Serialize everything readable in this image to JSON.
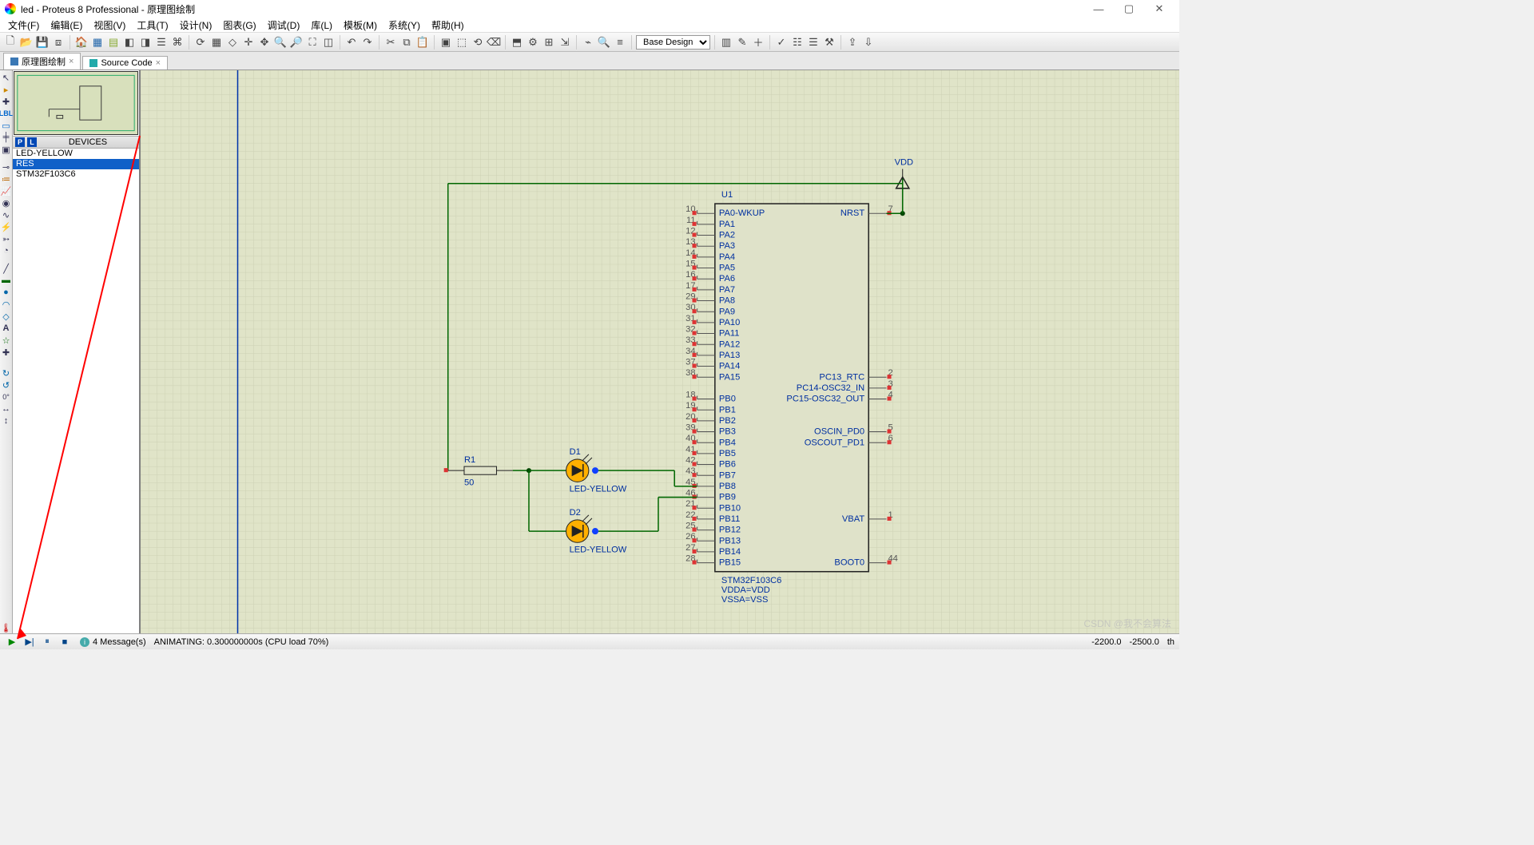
{
  "titlebar": {
    "title": "led - Proteus 8 Professional - 原理图绘制"
  },
  "menubar": [
    "文件(F)",
    "编辑(E)",
    "视图(V)",
    "工具(T)",
    "设计(N)",
    "图表(G)",
    "调试(D)",
    "库(L)",
    "模板(M)",
    "系统(Y)",
    "帮助(H)"
  ],
  "toolbar_combo": "Base Design",
  "tabs": [
    {
      "label": "原理图绘制",
      "kind": "sch"
    },
    {
      "label": "Source Code",
      "kind": "src"
    }
  ],
  "devices_header": "DEVICES",
  "devices": [
    "LED-YELLOW",
    "RES",
    "STM32F103C6"
  ],
  "devices_selected_index": 1,
  "schematic": {
    "vdd_label": "VDD",
    "u1_label": "U1",
    "u1_name": "STM32F103C6",
    "u1_vdda": "VDDA=VDD",
    "u1_vssa": "VSSA=VSS",
    "r1_label": "R1",
    "r1_value": "50",
    "d1_label": "D1",
    "d1_name": "LED-YELLOW",
    "d2_label": "D2",
    "d2_name": "LED-YELLOW",
    "left_pins": [
      {
        "num": "10",
        "name": "PA0-WKUP"
      },
      {
        "num": "11",
        "name": "PA1"
      },
      {
        "num": "12",
        "name": "PA2"
      },
      {
        "num": "13",
        "name": "PA3"
      },
      {
        "num": "14",
        "name": "PA4"
      },
      {
        "num": "15",
        "name": "PA5"
      },
      {
        "num": "16",
        "name": "PA6"
      },
      {
        "num": "17",
        "name": "PA7"
      },
      {
        "num": "29",
        "name": "PA8"
      },
      {
        "num": "30",
        "name": "PA9"
      },
      {
        "num": "31",
        "name": "PA10"
      },
      {
        "num": "32",
        "name": "PA11"
      },
      {
        "num": "33",
        "name": "PA12"
      },
      {
        "num": "34",
        "name": "PA13"
      },
      {
        "num": "37",
        "name": "PA14"
      },
      {
        "num": "38",
        "name": "PA15"
      },
      {
        "num": "",
        "name": ""
      },
      {
        "num": "18",
        "name": "PB0"
      },
      {
        "num": "19",
        "name": "PB1"
      },
      {
        "num": "20",
        "name": "PB2"
      },
      {
        "num": "39",
        "name": "PB3"
      },
      {
        "num": "40",
        "name": "PB4"
      },
      {
        "num": "41",
        "name": "PB5"
      },
      {
        "num": "42",
        "name": "PB6"
      },
      {
        "num": "43",
        "name": "PB7"
      },
      {
        "num": "45",
        "name": "PB8"
      },
      {
        "num": "46",
        "name": "PB9"
      },
      {
        "num": "21",
        "name": "PB10"
      },
      {
        "num": "22",
        "name": "PB11"
      },
      {
        "num": "25",
        "name": "PB12"
      },
      {
        "num": "26",
        "name": "PB13"
      },
      {
        "num": "27",
        "name": "PB14"
      },
      {
        "num": "28",
        "name": "PB15"
      }
    ],
    "right_pins": [
      {
        "num": "7",
        "name": "NRST",
        "row": 0
      },
      {
        "num": "2",
        "name": "PC13_RTC",
        "row": 15
      },
      {
        "num": "3",
        "name": "PC14-OSC32_IN",
        "row": 16
      },
      {
        "num": "4",
        "name": "PC15-OSC32_OUT",
        "row": 17
      },
      {
        "num": "5",
        "name": "OSCIN_PD0",
        "row": 20
      },
      {
        "num": "6",
        "name": "OSCOUT_PD1",
        "row": 21
      },
      {
        "num": "1",
        "name": "VBAT",
        "row": 28
      },
      {
        "num": "44",
        "name": "BOOT0",
        "row": 32
      }
    ]
  },
  "statusbar": {
    "messages": "4 Message(s)",
    "anim": "ANIMATING: 0.300000000s (CPU load 70%)",
    "coord_x": "-2200.0",
    "coord_y": "-2500.0",
    "coord_unit": "th"
  },
  "watermark": "CSDN @我不会算法"
}
